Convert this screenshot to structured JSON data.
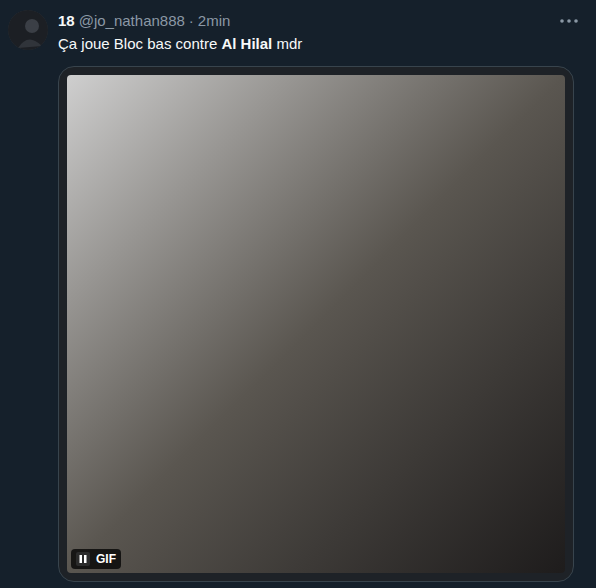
{
  "tweet": {
    "author": {
      "name": "18",
      "handle": "@jo_nathan888"
    },
    "separator": "·",
    "time": "2min",
    "text": [
      {
        "text": "Ça joue Bloc bas contre ",
        "bold": false
      },
      {
        "text": "Al Hilal",
        "bold": true
      },
      {
        "text": " mdr",
        "bold": false
      }
    ],
    "media": {
      "badge": "GIF"
    }
  }
}
